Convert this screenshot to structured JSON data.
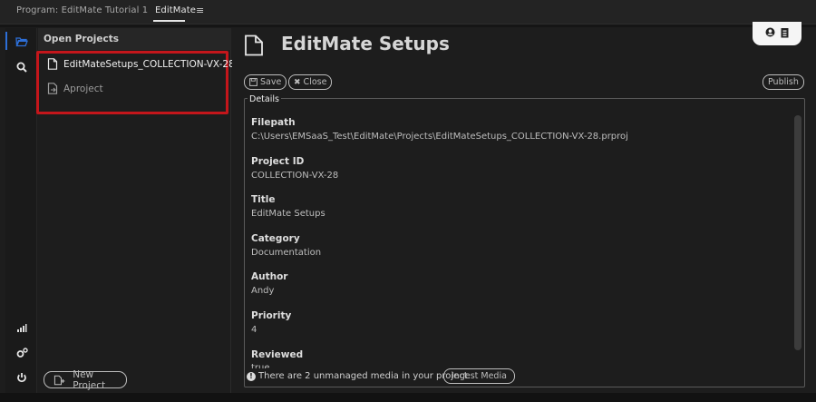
{
  "tabs": [
    {
      "label": "Program: EditMate Tutorial 1"
    },
    {
      "label": "EditMate"
    }
  ],
  "rail": {
    "icons": [
      "folder-icon",
      "search-icon",
      "signal-bars-icon",
      "gears-icon",
      "power-icon"
    ]
  },
  "projects": {
    "heading": "Open Projects",
    "items": [
      {
        "label": "EditMateSetups_COLLECTION-VX-28",
        "icon": "document-icon"
      },
      {
        "label": "Aproject",
        "icon": "document-import-icon"
      }
    ],
    "new_project_label": "New Project"
  },
  "main": {
    "title": "EditMate Setups",
    "save_label": "Save",
    "close_label": "Close",
    "publish_label": "Publish",
    "details_legend": "Details",
    "fields": [
      {
        "label": "Filepath",
        "value": "C:\\Users\\EMSaaS_Test\\EditMate\\Projects\\EditMateSetups_COLLECTION-VX-28.prproj"
      },
      {
        "label": "Project ID",
        "value": "COLLECTION-VX-28"
      },
      {
        "label": "Title",
        "value": "EditMate Setups"
      },
      {
        "label": "Category",
        "value": "Documentation"
      },
      {
        "label": "Author",
        "value": "Andy"
      },
      {
        "label": "Priority",
        "value": "4"
      },
      {
        "label": "Reviewed",
        "value": "true"
      }
    ],
    "footer_message": "There are 2 unmanaged media in your project.",
    "ingest_label": "Ingest Media"
  },
  "colors": {
    "accent": "#2d6fd8",
    "highlight_box": "#c4161b",
    "background": "#1d1d1d"
  }
}
